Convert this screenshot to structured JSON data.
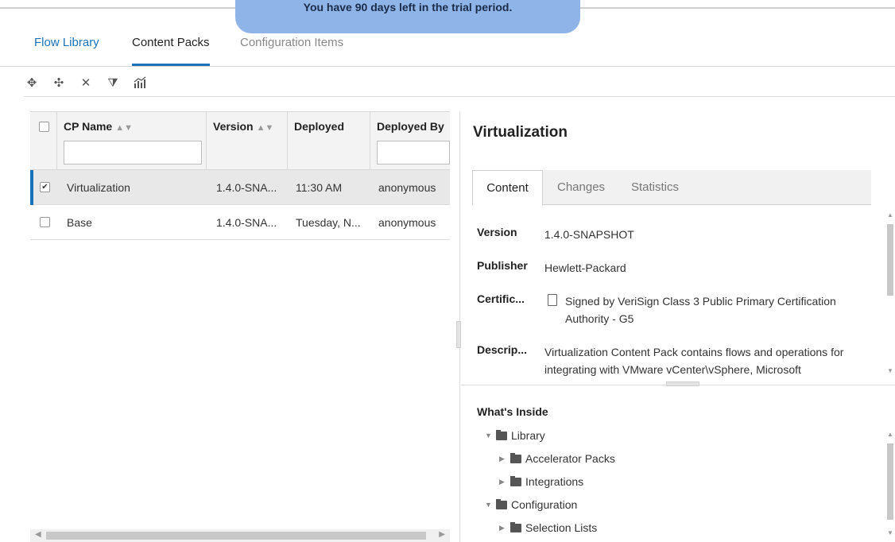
{
  "banner": {
    "text": "You have 90 days left in the trial period."
  },
  "tabs": [
    {
      "label": "Flow Library"
    },
    {
      "label": "Content Packs"
    },
    {
      "label": "Configuration Items"
    }
  ],
  "toolbar": {
    "icons": [
      "deploy-icon",
      "rollback-icon",
      "delete-icon",
      "filter-clear-icon",
      "report-icon"
    ],
    "glyphs": [
      "✥",
      "✣",
      "✕",
      "⧩",
      "⧉"
    ]
  },
  "grid": {
    "columns": [
      {
        "label": "CP Name"
      },
      {
        "label": "Version"
      },
      {
        "label": "Deployed"
      },
      {
        "label": "Deployed By"
      }
    ],
    "rows": [
      {
        "selected": true,
        "name": "Virtualization",
        "version": "1.4.0-SNA...",
        "deployed": "11:30 AM",
        "deployed_by": "anonymous"
      },
      {
        "selected": false,
        "name": "Base",
        "version": "1.4.0-SNA...",
        "deployed": "Tuesday, N...",
        "deployed_by": "anonymous"
      }
    ]
  },
  "detail": {
    "title": "Virtualization",
    "tabs": {
      "content": "Content",
      "changes": "Changes",
      "statistics": "Statistics"
    },
    "props": {
      "version_key": "Version",
      "version_val": "1.4.0-SNAPSHOT",
      "publisher_key": "Publisher",
      "publisher_val": "Hewlett-Packard",
      "cert_key": "Certific...",
      "cert_val": "Signed by VeriSign Class 3 Public Primary Certification Authority - G5",
      "desc_key": "Descrip...",
      "desc_val": "Virtualization Content Pack contains flows and operations for integrating with VMware vCenter\\vSphere, Microsoft"
    },
    "whats_inside": {
      "title": "What's Inside",
      "library": "Library",
      "accelerator": "Accelerator Packs",
      "integrations": "Integrations",
      "configuration": "Configuration",
      "selection_lists": "Selection Lists"
    }
  },
  "colors": {
    "accent": "#1a73b8",
    "banner": "#8fb4e8"
  }
}
